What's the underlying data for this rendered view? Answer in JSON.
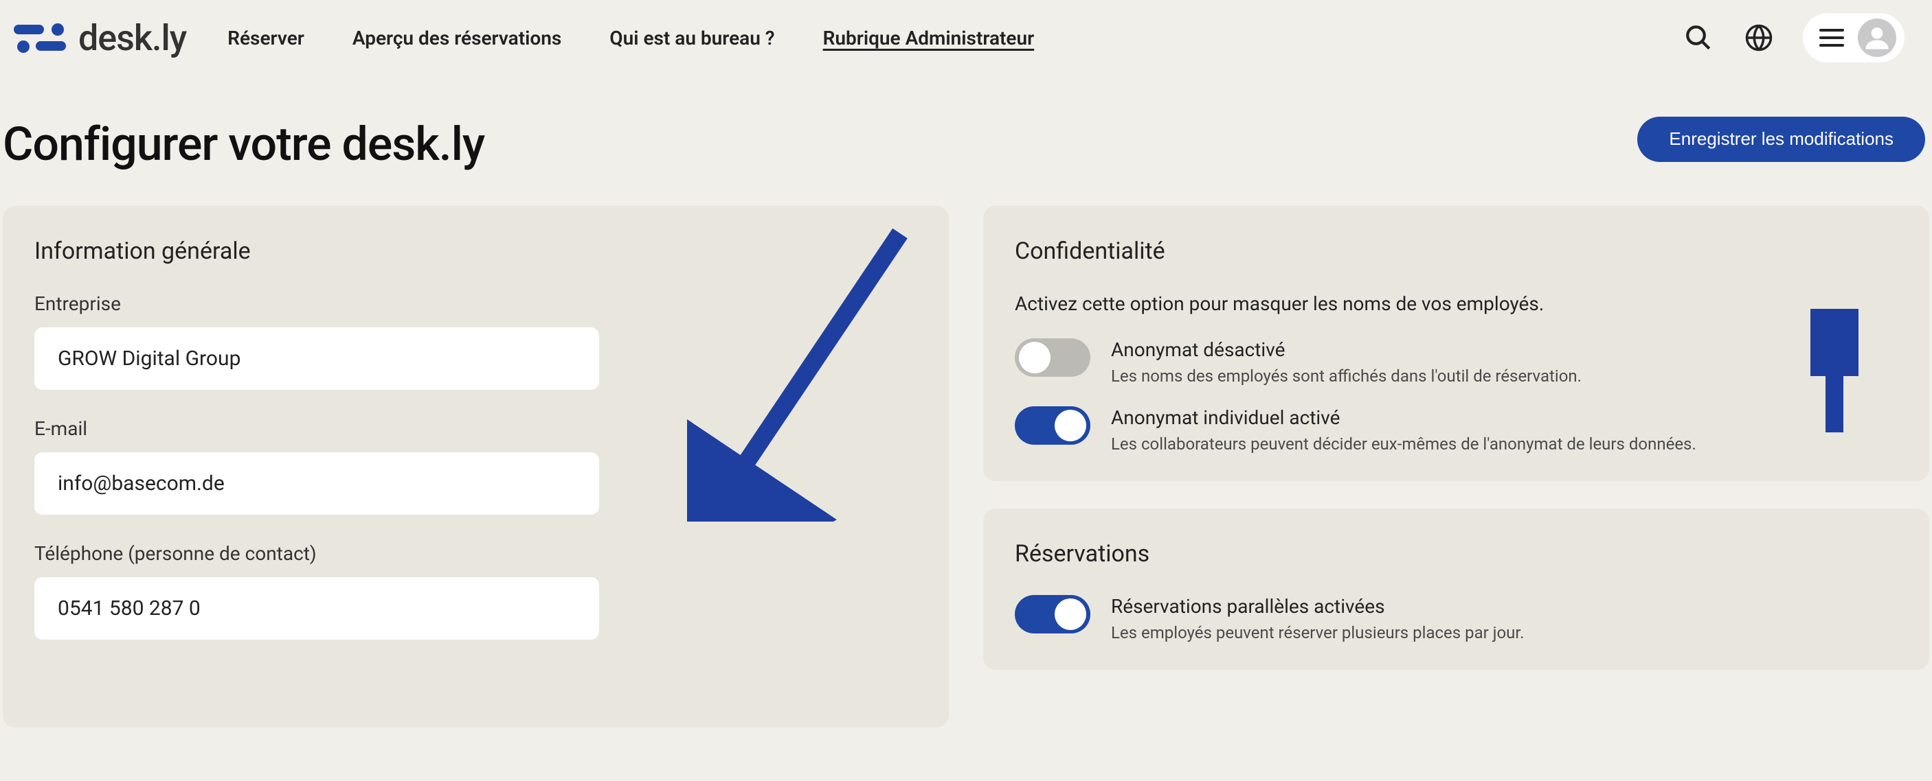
{
  "brand": {
    "name": "desk.ly"
  },
  "nav": {
    "items": [
      {
        "label": "Réserver",
        "active": false
      },
      {
        "label": "Aperçu des réservations",
        "active": false
      },
      {
        "label": "Qui est au bureau ?",
        "active": false
      },
      {
        "label": "Rubrique Administrateur",
        "active": true
      }
    ]
  },
  "page": {
    "title": "Configurer votre desk.ly",
    "save_label": "Enregistrer les modifications"
  },
  "general": {
    "title": "Information générale",
    "company_label": "Entreprise",
    "company_value": "GROW Digital Group",
    "email_label": "E-mail",
    "email_value": "info@basecom.de",
    "phone_label": "Téléphone (personne de contact)",
    "phone_value": "0541 580 287 0"
  },
  "privacy": {
    "title": "Confidentialité",
    "desc": "Activez cette option pour masquer les noms de vos employés.",
    "toggle1": {
      "title": "Anonymat désactivé",
      "desc": "Les noms des employés sont affichés dans l'outil de réservation.",
      "on": false
    },
    "toggle2": {
      "title": "Anonymat individuel activé",
      "desc": "Les collaborateurs peuvent décider eux-mêmes de l'anonymat de leurs données.",
      "on": true
    }
  },
  "reservations": {
    "title": "Réservations",
    "toggle1": {
      "title": "Réservations parallèles activées",
      "desc": "Les employés peuvent réserver plusieurs places par jour.",
      "on": true
    }
  },
  "annotations": {
    "arrow1": "pointer-to-general-card",
    "arrow2": "pointer-to-save-button"
  }
}
